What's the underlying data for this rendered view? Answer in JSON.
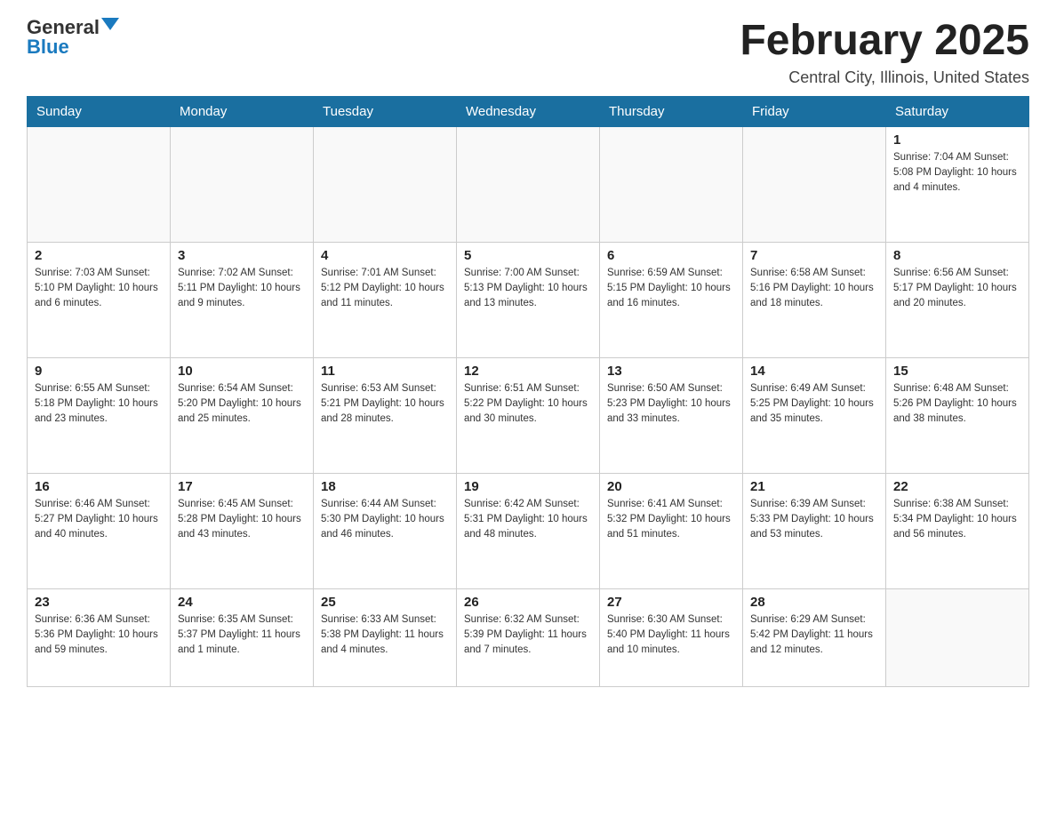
{
  "header": {
    "logo_general": "General",
    "logo_blue": "Blue",
    "month_title": "February 2025",
    "location": "Central City, Illinois, United States"
  },
  "days_of_week": [
    "Sunday",
    "Monday",
    "Tuesday",
    "Wednesday",
    "Thursday",
    "Friday",
    "Saturday"
  ],
  "weeks": [
    [
      {
        "day": "",
        "info": ""
      },
      {
        "day": "",
        "info": ""
      },
      {
        "day": "",
        "info": ""
      },
      {
        "day": "",
        "info": ""
      },
      {
        "day": "",
        "info": ""
      },
      {
        "day": "",
        "info": ""
      },
      {
        "day": "1",
        "info": "Sunrise: 7:04 AM\nSunset: 5:08 PM\nDaylight: 10 hours\nand 4 minutes."
      }
    ],
    [
      {
        "day": "2",
        "info": "Sunrise: 7:03 AM\nSunset: 5:10 PM\nDaylight: 10 hours\nand 6 minutes."
      },
      {
        "day": "3",
        "info": "Sunrise: 7:02 AM\nSunset: 5:11 PM\nDaylight: 10 hours\nand 9 minutes."
      },
      {
        "day": "4",
        "info": "Sunrise: 7:01 AM\nSunset: 5:12 PM\nDaylight: 10 hours\nand 11 minutes."
      },
      {
        "day": "5",
        "info": "Sunrise: 7:00 AM\nSunset: 5:13 PM\nDaylight: 10 hours\nand 13 minutes."
      },
      {
        "day": "6",
        "info": "Sunrise: 6:59 AM\nSunset: 5:15 PM\nDaylight: 10 hours\nand 16 minutes."
      },
      {
        "day": "7",
        "info": "Sunrise: 6:58 AM\nSunset: 5:16 PM\nDaylight: 10 hours\nand 18 minutes."
      },
      {
        "day": "8",
        "info": "Sunrise: 6:56 AM\nSunset: 5:17 PM\nDaylight: 10 hours\nand 20 minutes."
      }
    ],
    [
      {
        "day": "9",
        "info": "Sunrise: 6:55 AM\nSunset: 5:18 PM\nDaylight: 10 hours\nand 23 minutes."
      },
      {
        "day": "10",
        "info": "Sunrise: 6:54 AM\nSunset: 5:20 PM\nDaylight: 10 hours\nand 25 minutes."
      },
      {
        "day": "11",
        "info": "Sunrise: 6:53 AM\nSunset: 5:21 PM\nDaylight: 10 hours\nand 28 minutes."
      },
      {
        "day": "12",
        "info": "Sunrise: 6:51 AM\nSunset: 5:22 PM\nDaylight: 10 hours\nand 30 minutes."
      },
      {
        "day": "13",
        "info": "Sunrise: 6:50 AM\nSunset: 5:23 PM\nDaylight: 10 hours\nand 33 minutes."
      },
      {
        "day": "14",
        "info": "Sunrise: 6:49 AM\nSunset: 5:25 PM\nDaylight: 10 hours\nand 35 minutes."
      },
      {
        "day": "15",
        "info": "Sunrise: 6:48 AM\nSunset: 5:26 PM\nDaylight: 10 hours\nand 38 minutes."
      }
    ],
    [
      {
        "day": "16",
        "info": "Sunrise: 6:46 AM\nSunset: 5:27 PM\nDaylight: 10 hours\nand 40 minutes."
      },
      {
        "day": "17",
        "info": "Sunrise: 6:45 AM\nSunset: 5:28 PM\nDaylight: 10 hours\nand 43 minutes."
      },
      {
        "day": "18",
        "info": "Sunrise: 6:44 AM\nSunset: 5:30 PM\nDaylight: 10 hours\nand 46 minutes."
      },
      {
        "day": "19",
        "info": "Sunrise: 6:42 AM\nSunset: 5:31 PM\nDaylight: 10 hours\nand 48 minutes."
      },
      {
        "day": "20",
        "info": "Sunrise: 6:41 AM\nSunset: 5:32 PM\nDaylight: 10 hours\nand 51 minutes."
      },
      {
        "day": "21",
        "info": "Sunrise: 6:39 AM\nSunset: 5:33 PM\nDaylight: 10 hours\nand 53 minutes."
      },
      {
        "day": "22",
        "info": "Sunrise: 6:38 AM\nSunset: 5:34 PM\nDaylight: 10 hours\nand 56 minutes."
      }
    ],
    [
      {
        "day": "23",
        "info": "Sunrise: 6:36 AM\nSunset: 5:36 PM\nDaylight: 10 hours\nand 59 minutes."
      },
      {
        "day": "24",
        "info": "Sunrise: 6:35 AM\nSunset: 5:37 PM\nDaylight: 11 hours\nand 1 minute."
      },
      {
        "day": "25",
        "info": "Sunrise: 6:33 AM\nSunset: 5:38 PM\nDaylight: 11 hours\nand 4 minutes."
      },
      {
        "day": "26",
        "info": "Sunrise: 6:32 AM\nSunset: 5:39 PM\nDaylight: 11 hours\nand 7 minutes."
      },
      {
        "day": "27",
        "info": "Sunrise: 6:30 AM\nSunset: 5:40 PM\nDaylight: 11 hours\nand 10 minutes."
      },
      {
        "day": "28",
        "info": "Sunrise: 6:29 AM\nSunset: 5:42 PM\nDaylight: 11 hours\nand 12 minutes."
      },
      {
        "day": "",
        "info": ""
      }
    ]
  ]
}
